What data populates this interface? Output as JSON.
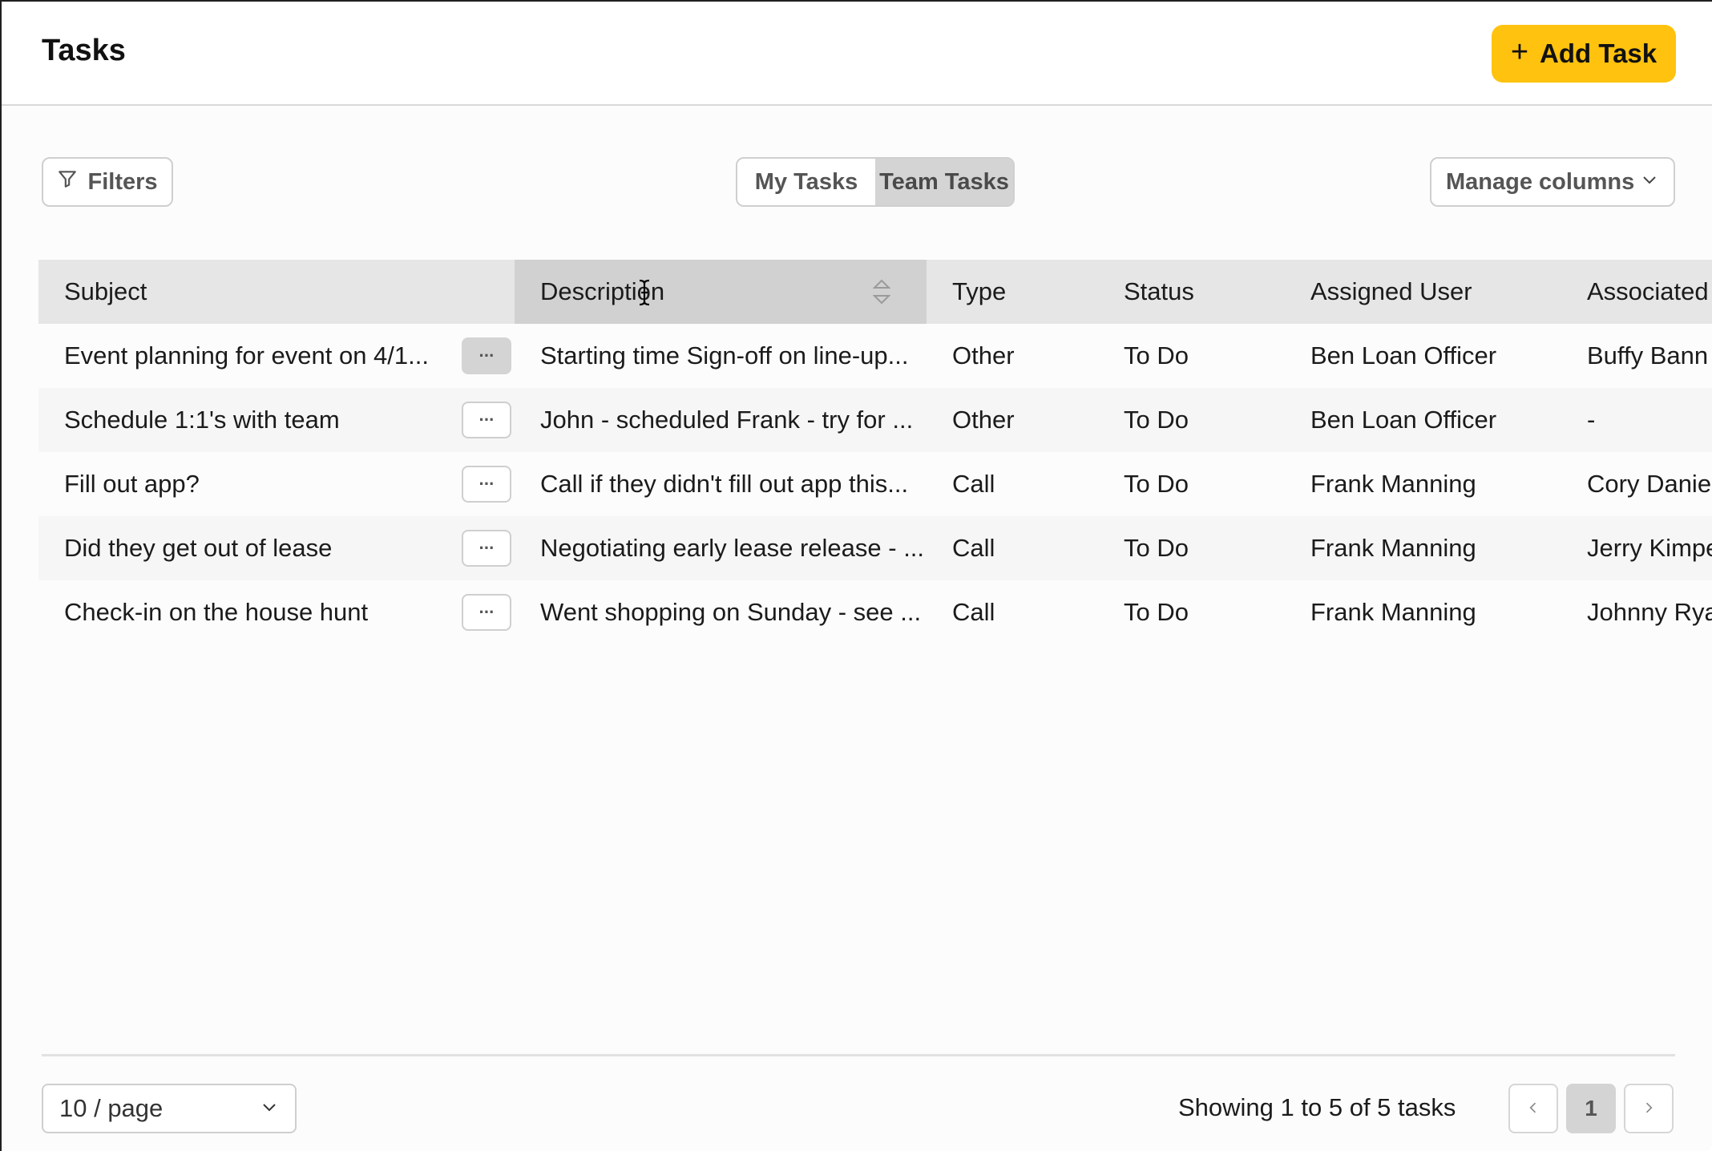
{
  "header": {
    "title": "Tasks",
    "add_button_label": "Add Task",
    "add_icon": "plus-icon"
  },
  "toolbar": {
    "filters_label": "Filters",
    "filters_icon": "filter-icon",
    "view_toggle": {
      "my_tasks": "My Tasks",
      "team_tasks": "Team Tasks",
      "selected": "Team Tasks"
    },
    "manage_columns_label": "Manage columns"
  },
  "table": {
    "columns": [
      "Subject",
      "Description",
      "Type",
      "Status",
      "Assigned User",
      "Associated"
    ],
    "sorted_column": "Description",
    "rows": [
      {
        "subject": "Event planning for event on 4/1...",
        "description": "Starting time Sign-off on line-up...",
        "type": "Other",
        "status": "To Do",
        "assigned_user": "Ben Loan Officer",
        "associated": "Buffy Bann"
      },
      {
        "subject": "Schedule 1:1's with team",
        "description": "John - scheduled Frank - try for ...",
        "type": "Other",
        "status": "To Do",
        "assigned_user": "Ben Loan Officer",
        "associated": "-"
      },
      {
        "subject": "Fill out app?",
        "description": "Call if they didn't fill out app this...",
        "type": "Call",
        "status": "To Do",
        "assigned_user": "Frank Manning",
        "associated": "Cory Danie"
      },
      {
        "subject": "Did they get out of lease",
        "description": "Negotiating early lease release - ...",
        "type": "Call",
        "status": "To Do",
        "assigned_user": "Frank Manning",
        "associated": "Jerry Kimpe"
      },
      {
        "subject": "Check-in on the house hunt",
        "description": "Went shopping on Sunday - see ...",
        "type": "Call",
        "status": "To Do",
        "assigned_user": "Frank Manning",
        "associated": "Johnny Rya"
      }
    ],
    "row_more_label": "···"
  },
  "footer": {
    "per_page": "10 / page",
    "showing": "Showing 1 to 5 of 5 tasks",
    "current_page": "1"
  },
  "colors": {
    "accent": "#ffc20e",
    "header_bg": "#e6e6e6",
    "sorted_header_bg": "#d1d1d1"
  }
}
